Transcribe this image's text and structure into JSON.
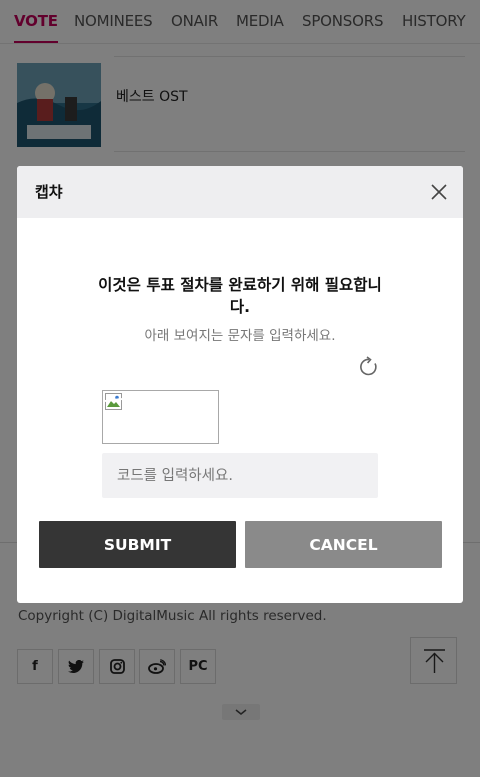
{
  "nav": {
    "tabs": [
      {
        "label": "VOTE",
        "active": true
      },
      {
        "label": "NOMINEES",
        "active": false
      },
      {
        "label": "ONAIR",
        "active": false
      },
      {
        "label": "MEDIA",
        "active": false
      },
      {
        "label": "SPONSORS",
        "active": false
      },
      {
        "label": "HISTORY",
        "active": false
      }
    ]
  },
  "category": {
    "label": "베스트 OST"
  },
  "footer": {
    "copyright": "Copyright (C) DigitalMusic All rights reserved.",
    "social": [
      {
        "name": "facebook-icon",
        "glyph": "f"
      },
      {
        "name": "twitter-icon",
        "glyph": ""
      },
      {
        "name": "instagram-icon",
        "glyph": ""
      },
      {
        "name": "weibo-icon",
        "glyph": ""
      },
      {
        "name": "pc-link",
        "glyph": "PC"
      }
    ]
  },
  "modal": {
    "title": "캡챠",
    "message": "이것은 투표 절차를 완료하기 위해 필요합니다.",
    "instruction": "아래 보여지는 문자를 입력하세요.",
    "input_placeholder": "코드를 입력하세요.",
    "submit_label": "SUBMIT",
    "cancel_label": "CANCEL"
  },
  "colors": {
    "accent": "#c4005a",
    "submit": "#353535",
    "cancel": "#8a8a8a"
  }
}
